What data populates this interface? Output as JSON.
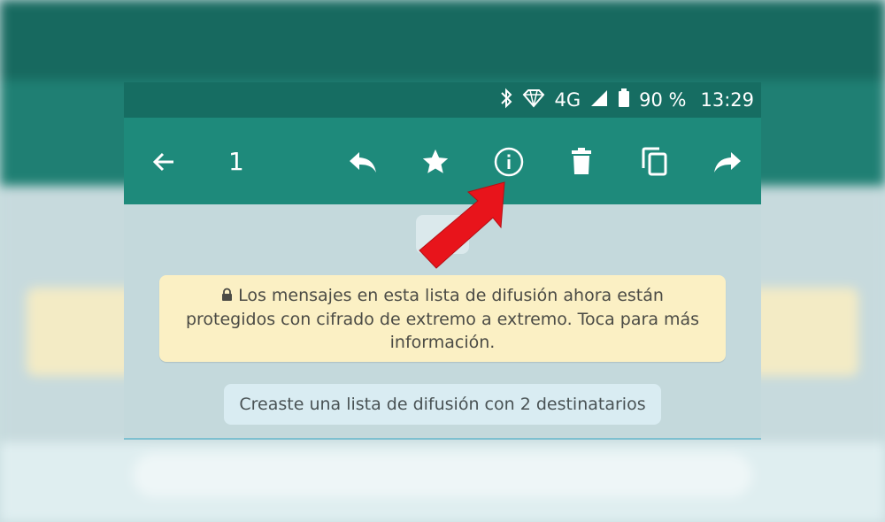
{
  "status_bar": {
    "network": "4G",
    "battery": "90 %",
    "time": "13:29"
  },
  "toolbar": {
    "selected_count": "1",
    "icons": [
      "back-arrow-icon",
      "reply-icon",
      "star-icon",
      "info-icon",
      "delete-icon",
      "copy-icon",
      "forward-icon"
    ]
  },
  "chat": {
    "encryption_notice": "Los mensajes en esta lista de difusión ahora están protegidos con cifrado de extremo a extremo. Toca para más información.",
    "system_message": "Creaste una lista de difusión con 2 destinatarios"
  },
  "colors": {
    "status_bar": "#166d62",
    "toolbar": "#1e8a7b",
    "notice_bg": "#fbf0c4",
    "arrow": "#e8141b"
  }
}
